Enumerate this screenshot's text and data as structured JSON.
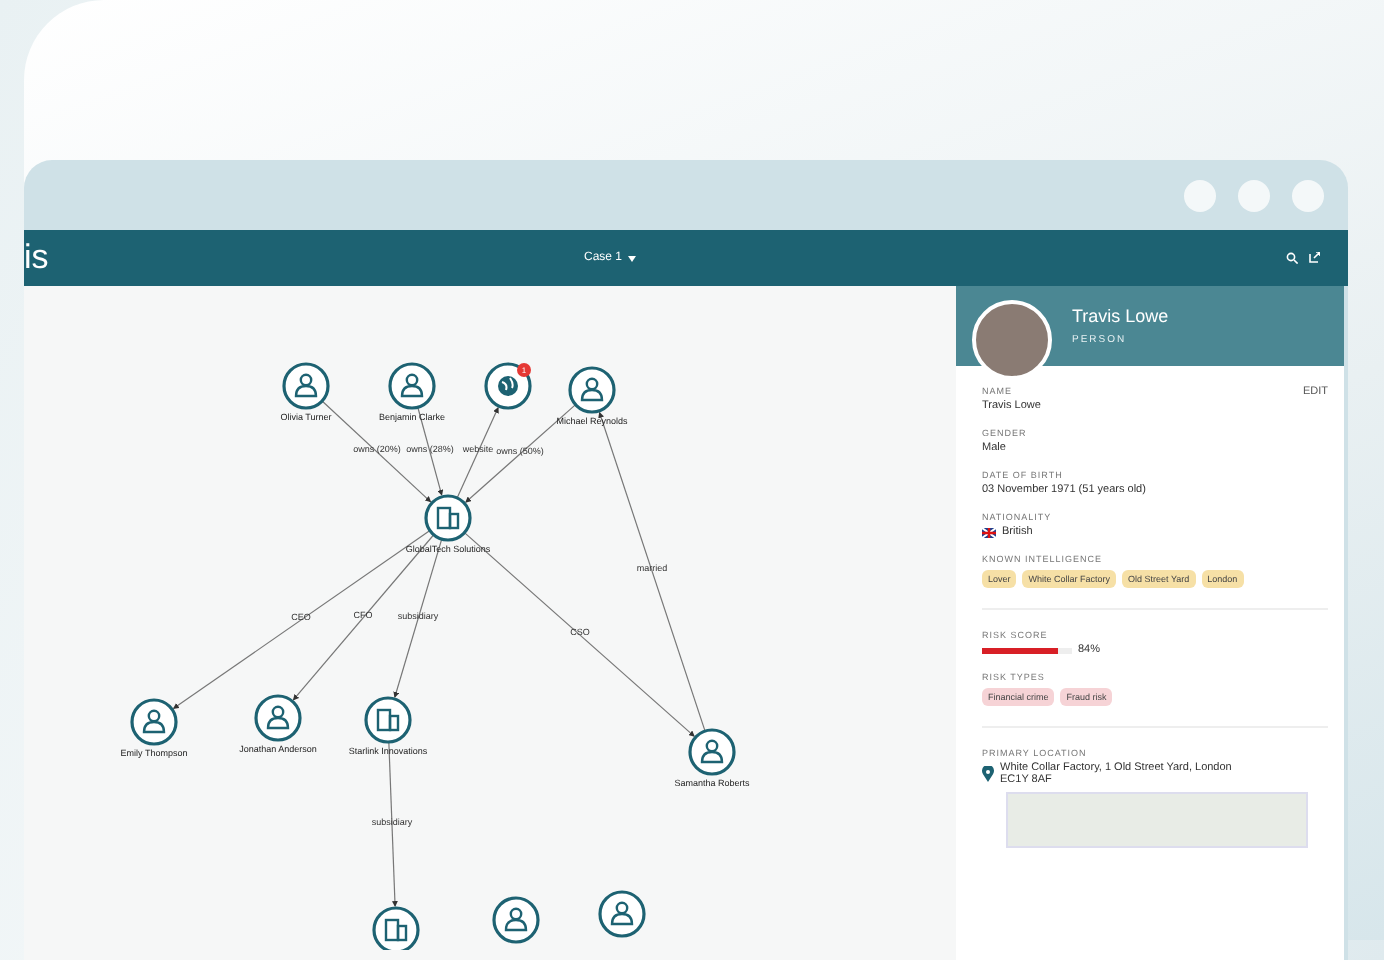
{
  "header": {
    "logo_fragment": "is",
    "case_menu": "Case 1"
  },
  "graph": {
    "nodes": [
      {
        "kind": "person",
        "label": "Olivia Turner"
      },
      {
        "kind": "person",
        "label": "Benjamin Clarke"
      },
      {
        "kind": "web",
        "badge": "1"
      },
      {
        "kind": "person",
        "label": "Michael Reynolds"
      },
      {
        "kind": "company",
        "label": "GlobalTech Solutions"
      },
      {
        "kind": "person",
        "label": "Emily Thompson"
      },
      {
        "kind": "person",
        "label": "Jonathan Anderson"
      },
      {
        "kind": "company",
        "label": "Starlink Innovations"
      },
      {
        "kind": "person",
        "label": "Samantha Roberts"
      },
      {
        "kind": "company"
      },
      {
        "kind": "person"
      },
      {
        "kind": "person"
      }
    ],
    "edges": [
      {
        "label": "owns (20%)"
      },
      {
        "label": "owns (28%)"
      },
      {
        "label": "website"
      },
      {
        "label": "owns (50%)"
      },
      {
        "label": "CEO"
      },
      {
        "label": "CFO"
      },
      {
        "label": "subsidiary"
      },
      {
        "label": "CSO"
      },
      {
        "label": "married"
      },
      {
        "label": "subsidiary"
      }
    ]
  },
  "profile": {
    "name": "Travis Lowe",
    "type": "PERSON",
    "edit": "EDIT",
    "fields": [
      {
        "label": "NAME",
        "value": "Travis Lowe"
      },
      {
        "label": "GENDER",
        "value": "Male"
      },
      {
        "label": "DATE OF BIRTH",
        "value": "03 November 1971 (51 years old)"
      }
    ],
    "nationality": {
      "label": "NATIONALITY",
      "value": "British"
    },
    "intelligence": {
      "label": "KNOWN INTELLIGENCE",
      "tags": [
        "Lover",
        "White Collar Factory",
        "Old Street Yard",
        "London"
      ]
    },
    "risk": {
      "label": "RISK SCORE",
      "level": 0.84,
      "reading": "84%"
    },
    "risk_types": {
      "label": "RISK TYPES",
      "tags": [
        "Financial crime",
        "Fraud risk"
      ]
    },
    "location": {
      "label": "PRIMARY LOCATION",
      "address": "White Collar Factory, 1 Old Street Yard, London EC1Y 8AF"
    }
  }
}
